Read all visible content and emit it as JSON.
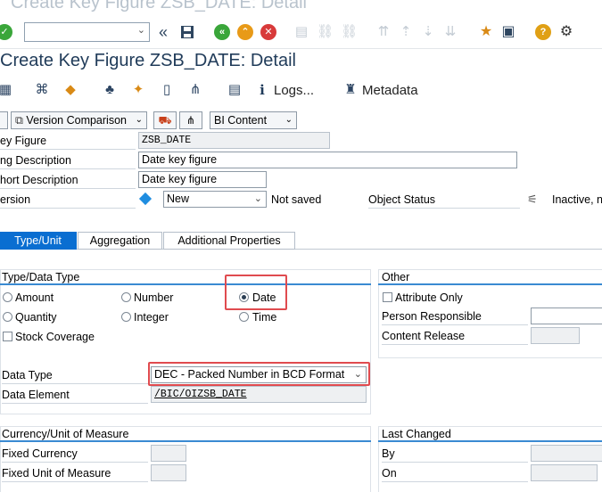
{
  "window": {
    "title": "Create Key Figure ZSB_DATE: Detail"
  },
  "page": {
    "title": "Create Key Figure ZSB_DATE: Detail"
  },
  "app_toolbar": {
    "logs_label": "Logs...",
    "metadata_label": "Metadata"
  },
  "secondary_toolbar": {
    "version_comparison_label": "Version Comparison",
    "bi_content_label": "BI Content"
  },
  "header_form": {
    "key_figure_label": "ey Figure",
    "key_figure_value": "ZSB_DATE",
    "long_description_label": "ng Description",
    "long_description_value": "Date key figure",
    "short_description_label": "hort Description",
    "short_description_value": "Date key figure",
    "version_label": "ersion",
    "version_value": "New",
    "version_status": "Not saved",
    "object_status_label": "Object Status",
    "object_status_value": "Inactive, n"
  },
  "tabs": [
    {
      "label": "Type/Unit",
      "active": true
    },
    {
      "label": "Aggregation",
      "active": false
    },
    {
      "label": "Additional Properties",
      "active": false
    }
  ],
  "type_group": {
    "title": "Type/Data Type",
    "options": [
      "Amount",
      "Number",
      "Date",
      "Quantity",
      "Integer",
      "Time"
    ],
    "selected": "Date",
    "stock_coverage_label": "Stock Coverage",
    "data_type_label": "Data Type",
    "data_type_value": "DEC - Packed Number in BCD Format",
    "data_element_label": "Data Element",
    "data_element_value": "/BIC/OIZSB_DATE"
  },
  "other_group": {
    "title": "Other",
    "attribute_only_label": "Attribute Only",
    "person_responsible_label": "Person Responsible",
    "content_release_label": "Content Release"
  },
  "currency_group": {
    "title": "Currency/Unit of Measure",
    "fixed_currency_label": "Fixed Currency",
    "fixed_unit_label": "Fixed Unit of Measure"
  },
  "last_changed_group": {
    "title": "Last Changed",
    "by_label": "By",
    "on_label": "On"
  },
  "colors": {
    "accent": "#0a6ed1",
    "highlight": "#e04b4f",
    "title": "#213c5a"
  }
}
